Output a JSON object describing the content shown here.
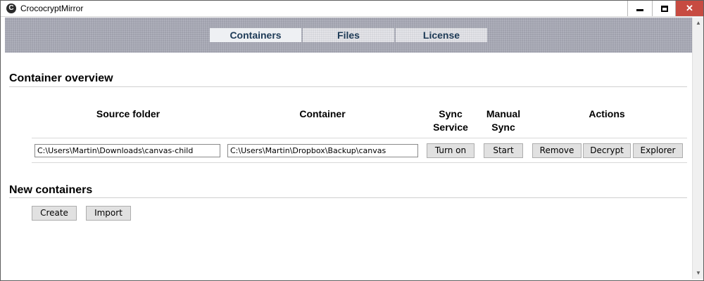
{
  "window": {
    "title": "CrococryptMirror",
    "minimize_icon": "minimize-icon",
    "maximize_icon": "maximize-icon",
    "close_glyph": "✕"
  },
  "tabs": [
    {
      "label": "Containers",
      "active": true
    },
    {
      "label": "Files",
      "active": false
    },
    {
      "label": "License",
      "active": false
    }
  ],
  "overview": {
    "title": "Container overview",
    "columns": {
      "source": "Source folder",
      "container": "Container",
      "sync_service_1": "Sync",
      "sync_service_2": "Service",
      "manual_sync_1": "Manual",
      "manual_sync_2": "Sync",
      "actions": "Actions"
    },
    "rows": [
      {
        "source_folder": "C:\\Users\\Martin\\Downloads\\canvas-child",
        "container": "C:\\Users\\Martin\\Dropbox\\Backup\\canvas",
        "sync_service_button": "Turn on",
        "manual_sync_button": "Start",
        "remove_button": "Remove",
        "decrypt_button": "Decrypt",
        "explorer_button": "Explorer"
      }
    ]
  },
  "new_containers": {
    "title": "New containers",
    "create_button": "Create",
    "import_button": "Import"
  },
  "scrollbar": {
    "up_glyph": "▲",
    "down_glyph": "▼"
  }
}
